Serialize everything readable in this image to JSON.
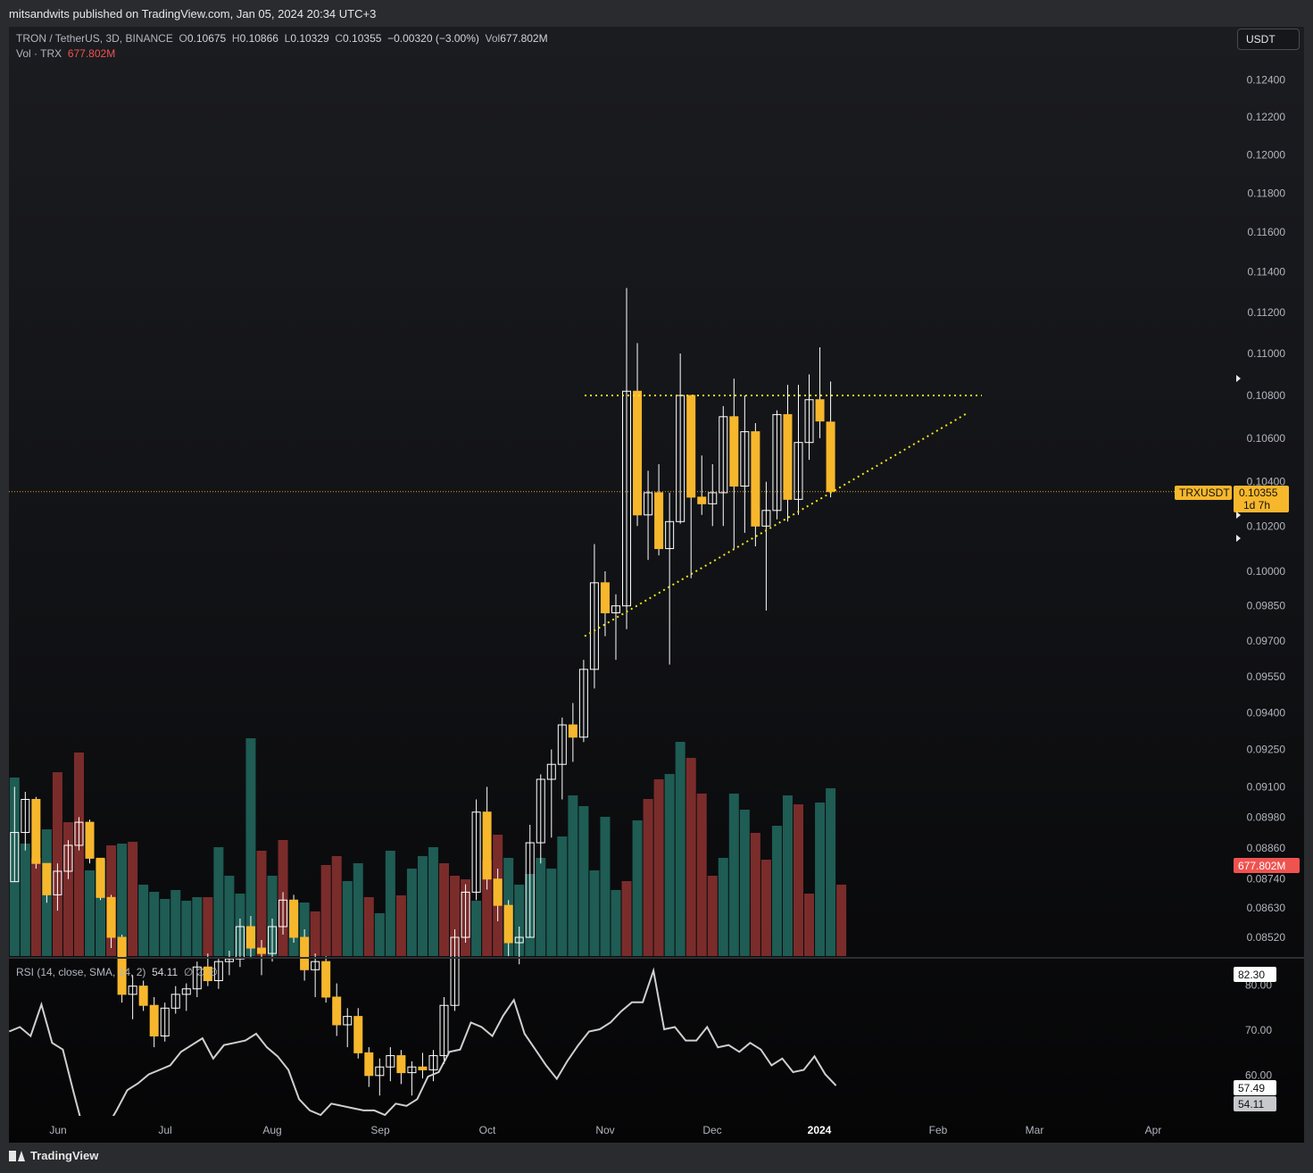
{
  "header": {
    "published": "mitsandwits published on TradingView.com, Jan 05, 2024 20:34 UTC+3"
  },
  "legend": {
    "symbol": "TRON / TetherUS, 3D, BINANCE",
    "open": "0.10675",
    "high": "0.10866",
    "low": "0.10329",
    "close": "0.10355",
    "change": "−0.00320 (−3.00%)",
    "vol": "677.802M",
    "vol_line_label": "Vol · TRX",
    "vol_line_value": "677.802M",
    "rsi_label": "RSI (14, close, SMA, 14, 2)",
    "rsi_value": "54.11",
    "rsi_extra": "∅ ∅ ∅"
  },
  "currency_button": "USDT",
  "price_tag": {
    "symbol": "TRXUSDT",
    "price": "0.10355",
    "countdown": "1d 7h"
  },
  "volume_tag": "677.802M",
  "rsi_tags": {
    "top": "82.30",
    "sma": "57.49",
    "rsi": "54.11"
  },
  "footer": {
    "brand": "TradingView"
  },
  "colors": {
    "bull_candle": "#ffffff",
    "bear_candle": "#f7b72c",
    "vol_up": "#1e5c54",
    "vol_down": "#7a2c2b",
    "trendline": "#f0e523",
    "rsi_line": "#cfcfcf"
  },
  "chart_data": {
    "type": "candlestick",
    "symbol": "TRXUSDT",
    "interval": "3D",
    "y_scale": "log",
    "price_ticks": [
      0.124,
      0.122,
      0.12,
      0.118,
      0.116,
      0.114,
      0.112,
      0.11,
      0.108,
      0.106,
      0.104,
      0.102,
      0.1,
      0.0985,
      0.097,
      0.0955,
      0.094,
      0.0925,
      0.091,
      0.0898,
      0.0886,
      0.0874,
      0.0863,
      0.0852
    ],
    "x_ticks": [
      "Jun",
      "Jul",
      "Aug",
      "Sep",
      "Oct",
      "Nov",
      "Dec",
      "2024",
      "Feb",
      "Mar",
      "Apr"
    ],
    "last_price": 0.10355,
    "candles": [
      {
        "o": 0.0873,
        "h": 0.091,
        "l": 0.0873,
        "c": 0.0892
      },
      {
        "o": 0.0892,
        "h": 0.0908,
        "l": 0.0885,
        "c": 0.0905
      },
      {
        "o": 0.0905,
        "h": 0.0906,
        "l": 0.0878,
        "c": 0.088
      },
      {
        "o": 0.088,
        "h": 0.088,
        "l": 0.0865,
        "c": 0.0868
      },
      {
        "o": 0.0868,
        "h": 0.088,
        "l": 0.0862,
        "c": 0.0877
      },
      {
        "o": 0.0877,
        "h": 0.0889,
        "l": 0.0874,
        "c": 0.0887
      },
      {
        "o": 0.0887,
        "h": 0.0898,
        "l": 0.0885,
        "c": 0.0896
      },
      {
        "o": 0.0896,
        "h": 0.0897,
        "l": 0.088,
        "c": 0.0882
      },
      {
        "o": 0.0882,
        "h": 0.0882,
        "l": 0.0866,
        "c": 0.0867
      },
      {
        "o": 0.0867,
        "h": 0.0868,
        "l": 0.0848,
        "c": 0.0852
      },
      {
        "o": 0.0852,
        "h": 0.0853,
        "l": 0.0828,
        "c": 0.0831
      },
      {
        "o": 0.0831,
        "h": 0.0838,
        "l": 0.0822,
        "c": 0.0834
      },
      {
        "o": 0.0834,
        "h": 0.0836,
        "l": 0.0825,
        "c": 0.0827
      },
      {
        "o": 0.0827,
        "h": 0.083,
        "l": 0.0812,
        "c": 0.0816
      },
      {
        "o": 0.0816,
        "h": 0.0828,
        "l": 0.0814,
        "c": 0.0826
      },
      {
        "o": 0.0826,
        "h": 0.0834,
        "l": 0.0824,
        "c": 0.0831
      },
      {
        "o": 0.0831,
        "h": 0.0835,
        "l": 0.0825,
        "c": 0.0833
      },
      {
        "o": 0.0833,
        "h": 0.0843,
        "l": 0.083,
        "c": 0.0841
      },
      {
        "o": 0.0841,
        "h": 0.0846,
        "l": 0.0834,
        "c": 0.0836
      },
      {
        "o": 0.0836,
        "h": 0.0844,
        "l": 0.0833,
        "c": 0.0843
      },
      {
        "o": 0.0843,
        "h": 0.0847,
        "l": 0.0838,
        "c": 0.0844
      },
      {
        "o": 0.0844,
        "h": 0.0859,
        "l": 0.0841,
        "c": 0.0856
      },
      {
        "o": 0.0856,
        "h": 0.086,
        "l": 0.0844,
        "c": 0.0848
      },
      {
        "o": 0.0848,
        "h": 0.0851,
        "l": 0.0838,
        "c": 0.0846
      },
      {
        "o": 0.0846,
        "h": 0.0859,
        "l": 0.0843,
        "c": 0.0856
      },
      {
        "o": 0.0856,
        "h": 0.0869,
        "l": 0.0853,
        "c": 0.0866
      },
      {
        "o": 0.0866,
        "h": 0.0868,
        "l": 0.085,
        "c": 0.0852
      },
      {
        "o": 0.0852,
        "h": 0.0855,
        "l": 0.0836,
        "c": 0.084
      },
      {
        "o": 0.084,
        "h": 0.0846,
        "l": 0.083,
        "c": 0.0843
      },
      {
        "o": 0.0843,
        "h": 0.0845,
        "l": 0.0828,
        "c": 0.083
      },
      {
        "o": 0.083,
        "h": 0.0835,
        "l": 0.0816,
        "c": 0.082
      },
      {
        "o": 0.082,
        "h": 0.0826,
        "l": 0.0812,
        "c": 0.0823
      },
      {
        "o": 0.0823,
        "h": 0.0826,
        "l": 0.0808,
        "c": 0.081
      },
      {
        "o": 0.081,
        "h": 0.0812,
        "l": 0.0798,
        "c": 0.0802
      },
      {
        "o": 0.0802,
        "h": 0.0808,
        "l": 0.0795,
        "c": 0.0805
      },
      {
        "o": 0.0805,
        "h": 0.0812,
        "l": 0.08,
        "c": 0.0809
      },
      {
        "o": 0.0809,
        "h": 0.0811,
        "l": 0.0799,
        "c": 0.0803
      },
      {
        "o": 0.0803,
        "h": 0.0807,
        "l": 0.0795,
        "c": 0.0805
      },
      {
        "o": 0.0805,
        "h": 0.081,
        "l": 0.0801,
        "c": 0.0804
      },
      {
        "o": 0.0804,
        "h": 0.0811,
        "l": 0.08,
        "c": 0.0809
      },
      {
        "o": 0.0809,
        "h": 0.083,
        "l": 0.0806,
        "c": 0.0827
      },
      {
        "o": 0.0827,
        "h": 0.0855,
        "l": 0.0825,
        "c": 0.0852
      },
      {
        "o": 0.0852,
        "h": 0.0872,
        "l": 0.085,
        "c": 0.0869
      },
      {
        "o": 0.0869,
        "h": 0.0905,
        "l": 0.0866,
        "c": 0.09
      },
      {
        "o": 0.09,
        "h": 0.091,
        "l": 0.087,
        "c": 0.0874
      },
      {
        "o": 0.0874,
        "h": 0.0878,
        "l": 0.0858,
        "c": 0.0864
      },
      {
        "o": 0.0864,
        "h": 0.0866,
        "l": 0.0845,
        "c": 0.085
      },
      {
        "o": 0.085,
        "h": 0.0856,
        "l": 0.0842,
        "c": 0.0852
      },
      {
        "o": 0.0852,
        "h": 0.0895,
        "l": 0.0852,
        "c": 0.0888
      },
      {
        "o": 0.0888,
        "h": 0.0915,
        "l": 0.088,
        "c": 0.0913
      },
      {
        "o": 0.0913,
        "h": 0.0925,
        "l": 0.089,
        "c": 0.0919
      },
      {
        "o": 0.0919,
        "h": 0.0938,
        "l": 0.0905,
        "c": 0.0935
      },
      {
        "o": 0.0935,
        "h": 0.0944,
        "l": 0.092,
        "c": 0.093
      },
      {
        "o": 0.093,
        "h": 0.0962,
        "l": 0.0928,
        "c": 0.0958
      },
      {
        "o": 0.0958,
        "h": 0.1012,
        "l": 0.095,
        "c": 0.0995
      },
      {
        "o": 0.0995,
        "h": 0.1,
        "l": 0.0972,
        "c": 0.0982
      },
      {
        "o": 0.0982,
        "h": 0.099,
        "l": 0.0962,
        "c": 0.0985
      },
      {
        "o": 0.0985,
        "h": 0.1132,
        "l": 0.0975,
        "c": 0.1082
      },
      {
        "o": 0.1082,
        "h": 0.1105,
        "l": 0.102,
        "c": 0.1025
      },
      {
        "o": 0.1025,
        "h": 0.1045,
        "l": 0.1005,
        "c": 0.1035
      },
      {
        "o": 0.1035,
        "h": 0.1048,
        "l": 0.1007,
        "c": 0.101
      },
      {
        "o": 0.101,
        "h": 0.1035,
        "l": 0.096,
        "c": 0.1022
      },
      {
        "o": 0.1022,
        "h": 0.11,
        "l": 0.1021,
        "c": 0.108
      },
      {
        "o": 0.108,
        "h": 0.108,
        "l": 0.0997,
        "c": 0.1033
      },
      {
        "o": 0.1033,
        "h": 0.1052,
        "l": 0.1025,
        "c": 0.103
      },
      {
        "o": 0.103,
        "h": 0.1048,
        "l": 0.102,
        "c": 0.1035
      },
      {
        "o": 0.1035,
        "h": 0.1075,
        "l": 0.102,
        "c": 0.107
      },
      {
        "o": 0.107,
        "h": 0.1088,
        "l": 0.101,
        "c": 0.1038
      },
      {
        "o": 0.1038,
        "h": 0.108,
        "l": 0.1017,
        "c": 0.1063
      },
      {
        "o": 0.1063,
        "h": 0.1067,
        "l": 0.1011,
        "c": 0.102
      },
      {
        "o": 0.102,
        "h": 0.104,
        "l": 0.0983,
        "c": 0.1027
      },
      {
        "o": 0.1027,
        "h": 0.1073,
        "l": 0.1023,
        "c": 0.1071
      },
      {
        "o": 0.1071,
        "h": 0.1085,
        "l": 0.1022,
        "c": 0.1032
      },
      {
        "o": 0.1032,
        "h": 0.1085,
        "l": 0.1025,
        "c": 0.1058
      },
      {
        "o": 0.1058,
        "h": 0.109,
        "l": 0.105,
        "c": 0.1078
      },
      {
        "o": 0.1078,
        "h": 0.1103,
        "l": 0.106,
        "c": 0.1068
      },
      {
        "o": 0.10675,
        "h": 0.10866,
        "l": 0.10329,
        "c": 0.10355
      }
    ],
    "volume": [
      {
        "v": 100,
        "up": true
      },
      {
        "v": 63,
        "up": true
      },
      {
        "v": 55,
        "up": false
      },
      {
        "v": 71,
        "up": true
      },
      {
        "v": 103,
        "up": false
      },
      {
        "v": 75,
        "up": false
      },
      {
        "v": 114,
        "up": false
      },
      {
        "v": 48,
        "up": true
      },
      {
        "v": 54,
        "up": true
      },
      {
        "v": 62,
        "up": false
      },
      {
        "v": 63,
        "up": true
      },
      {
        "v": 64,
        "up": false
      },
      {
        "v": 40,
        "up": true
      },
      {
        "v": 36,
        "up": true
      },
      {
        "v": 32,
        "up": true
      },
      {
        "v": 37,
        "up": true
      },
      {
        "v": 31,
        "up": true
      },
      {
        "v": 33,
        "up": true
      },
      {
        "v": 33,
        "up": false
      },
      {
        "v": 61,
        "up": true
      },
      {
        "v": 45,
        "up": true
      },
      {
        "v": 35,
        "up": true
      },
      {
        "v": 122,
        "up": true
      },
      {
        "v": 59,
        "up": false
      },
      {
        "v": 45,
        "up": true
      },
      {
        "v": 65,
        "up": false
      },
      {
        "v": 30,
        "up": true
      },
      {
        "v": 30,
        "up": true
      },
      {
        "v": 25,
        "up": false
      },
      {
        "v": 51,
        "up": false
      },
      {
        "v": 56,
        "up": false
      },
      {
        "v": 42,
        "up": true
      },
      {
        "v": 52,
        "up": true
      },
      {
        "v": 33,
        "up": false
      },
      {
        "v": 24,
        "up": true
      },
      {
        "v": 59,
        "up": true
      },
      {
        "v": 34,
        "up": false
      },
      {
        "v": 49,
        "up": true
      },
      {
        "v": 56,
        "up": true
      },
      {
        "v": 61,
        "up": true
      },
      {
        "v": 52,
        "up": false
      },
      {
        "v": 45,
        "up": false
      },
      {
        "v": 43,
        "up": false
      },
      {
        "v": 31,
        "up": true
      },
      {
        "v": 54,
        "up": false
      },
      {
        "v": 68,
        "up": false
      },
      {
        "v": 55,
        "up": true
      },
      {
        "v": 40,
        "up": true
      },
      {
        "v": 46,
        "up": true
      },
      {
        "v": 55,
        "up": true
      },
      {
        "v": 49,
        "up": true
      },
      {
        "v": 67,
        "up": true
      },
      {
        "v": 90,
        "up": true
      },
      {
        "v": 84,
        "up": true
      },
      {
        "v": 48,
        "up": true
      },
      {
        "v": 78,
        "up": true
      },
      {
        "v": 37,
        "up": true
      },
      {
        "v": 42,
        "up": false
      },
      {
        "v": 76,
        "up": true
      },
      {
        "v": 88,
        "up": false
      },
      {
        "v": 99,
        "up": false
      },
      {
        "v": 102,
        "up": true
      },
      {
        "v": 120,
        "up": true
      },
      {
        "v": 111,
        "up": false
      },
      {
        "v": 91,
        "up": false
      },
      {
        "v": 45,
        "up": false
      },
      {
        "v": 55,
        "up": true
      },
      {
        "v": 91,
        "up": true
      },
      {
        "v": 82,
        "up": true
      },
      {
        "v": 69,
        "up": false
      },
      {
        "v": 54,
        "up": false
      },
      {
        "v": 73,
        "up": true
      },
      {
        "v": 90,
        "up": true
      },
      {
        "v": 85,
        "up": false
      },
      {
        "v": 35,
        "up": false
      },
      {
        "v": 86,
        "up": true
      },
      {
        "v": 94,
        "up": true
      },
      {
        "v": 40,
        "up": false
      }
    ],
    "rsi": {
      "ylim": [
        40,
        85
      ],
      "ticks": [
        80,
        70,
        60
      ],
      "values": [
        69.5,
        70.5,
        68.5,
        75.5,
        67,
        65.5,
        56,
        47,
        46.5,
        48,
        52,
        56.5,
        58,
        60,
        61,
        62,
        65,
        66.5,
        68,
        63.5,
        66.5,
        67,
        67.5,
        69,
        66,
        64,
        61,
        54.5,
        52,
        51,
        53.5,
        53,
        52.5,
        52,
        52,
        51,
        53.5,
        53,
        54.5,
        59.5,
        60.5,
        65,
        65.5,
        71.5,
        70.5,
        68.5,
        73,
        76.5,
        69,
        65.5,
        62,
        59,
        63,
        66.5,
        69.5,
        70,
        71.5,
        74,
        76,
        76,
        83,
        70,
        70.5,
        67.5,
        67.5,
        70.5,
        66,
        66.5,
        65,
        67,
        65.5,
        62,
        63.5,
        60.5,
        61,
        64,
        60,
        57.5
      ]
    }
  }
}
